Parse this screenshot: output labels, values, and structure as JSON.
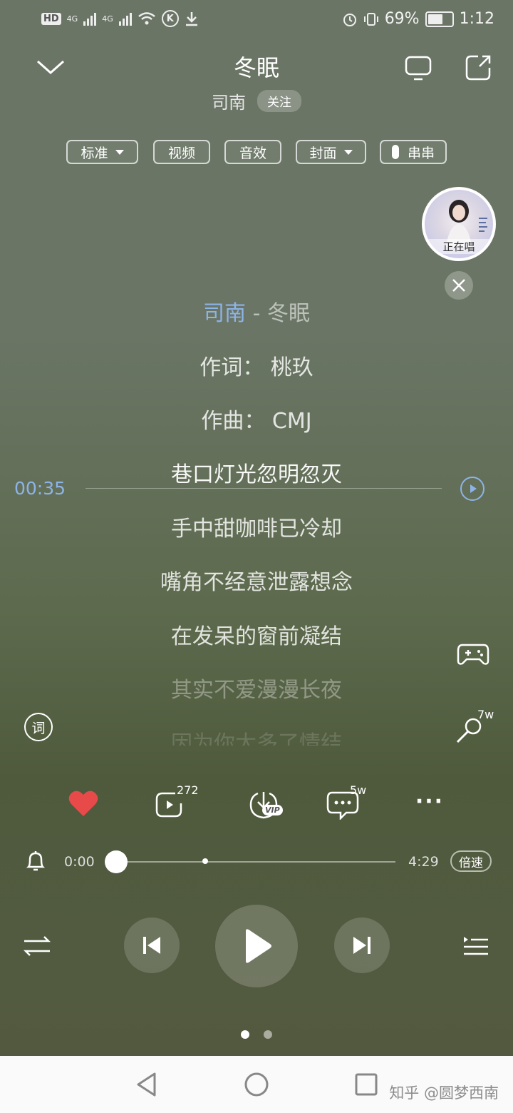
{
  "status_bar": {
    "hd_badge": "HD",
    "network1": "4G",
    "network2": "4G",
    "vpn_icon": "K",
    "battery_percent": "69%",
    "time": "1:12"
  },
  "header": {
    "song_title": "冬眠",
    "artist": "司南",
    "follow_label": "关注"
  },
  "tags": {
    "quality": "标准",
    "video": "视频",
    "effects": "音效",
    "cover": "封面",
    "chuanchuan": "串串"
  },
  "now_singing": {
    "label": "正在唱"
  },
  "lyrics": {
    "header_artist": "司南",
    "header_separator": " - ",
    "header_song": "冬眠",
    "lines": [
      "作词：  桃玖",
      "作曲：  CMJ",
      "巷口灯光忽明忽灭",
      "手中甜咖啡已冷却",
      "嘴角不经意泄露想念",
      "在发呆的窗前凝结",
      "其实不爱漫漫长夜",
      "因为你太多了情结"
    ],
    "seek_time": "00:35"
  },
  "side": {
    "lyric_button": "词",
    "karaoke_count": "7w"
  },
  "actions": {
    "play_count": "272",
    "download_badge": "VIP",
    "comment_count": "5w",
    "more": "···"
  },
  "progress": {
    "current": "0:00",
    "total": "4:29",
    "speed_label": "倍速",
    "fraction": 0.0
  },
  "watermark": "知乎 @圆梦西南",
  "colors": {
    "accent_blue": "#8db4e8",
    "heart_red": "#e84a4a"
  }
}
